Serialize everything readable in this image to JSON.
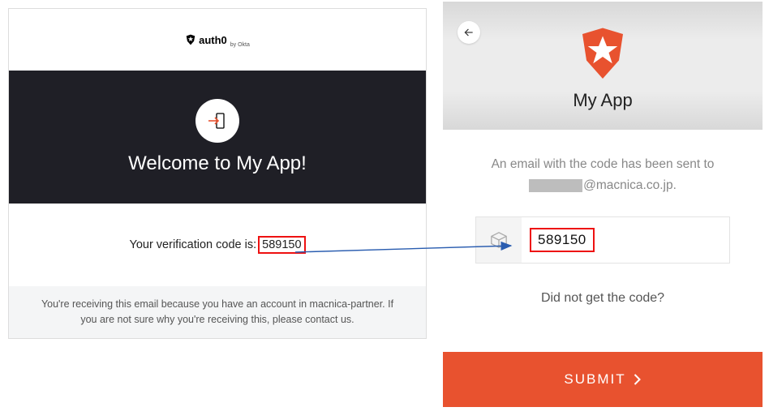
{
  "email": {
    "brand": "auth0",
    "brand_byline": "by Okta",
    "hero_title": "Welcome to My App!",
    "body_prefix": "Your verification code is:",
    "code": "589150",
    "footer": "You're receiving this email because you have an account in macnica-partner. If you are not sure why you're receiving this, please contact us."
  },
  "app": {
    "title": "My App",
    "sent_line": "An email with the code has been sent to",
    "email_visible_part": "@macnica.co.jp.",
    "code_value": "589150",
    "resend": "Did not get the code?",
    "submit": "SUBMIT"
  },
  "colors": {
    "accent": "#e8522f",
    "highlight_border": "#e11"
  }
}
